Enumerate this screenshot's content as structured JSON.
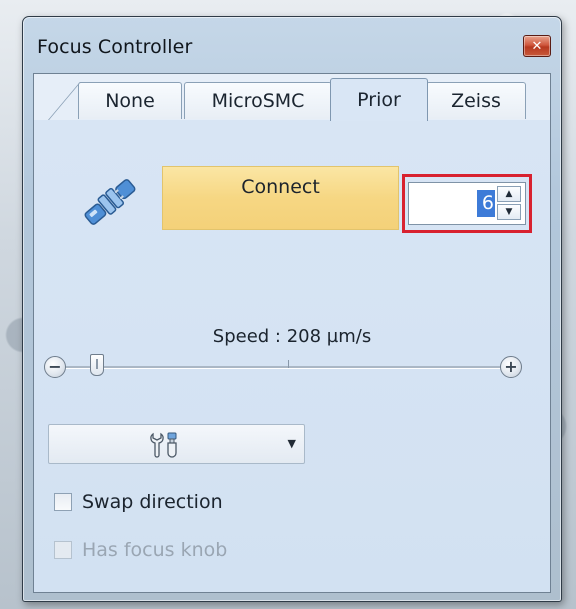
{
  "window": {
    "title": "Focus Controller",
    "close_glyph": "✕"
  },
  "tabs": [
    {
      "label": "None",
      "active": false
    },
    {
      "label": "MicroSMC",
      "active": false
    },
    {
      "label": "Prior",
      "active": true
    },
    {
      "label": "Zeiss",
      "active": false
    }
  ],
  "controls": {
    "connect_label": "Connect",
    "stepper_value": "6",
    "step_up_glyph": "▲",
    "step_down_glyph": "▼",
    "speed_text": "Speed : 208 µm/s",
    "minus_glyph": "−",
    "plus_glyph": "+",
    "dropdown_arrow": "▼",
    "dropdown_icon": "tools-icon"
  },
  "checkboxes": {
    "swap_direction": {
      "label": "Swap direction",
      "checked": false,
      "enabled": true
    },
    "has_focus_knob": {
      "label": "Has focus knob",
      "checked": false,
      "enabled": false
    }
  },
  "icons": {
    "connection": "plug-connection-icon"
  },
  "colors": {
    "connect_button": "#f6d783",
    "highlight_border": "#d8212f",
    "selection": "#3d7bd8",
    "close_button": "#c85a3b"
  }
}
